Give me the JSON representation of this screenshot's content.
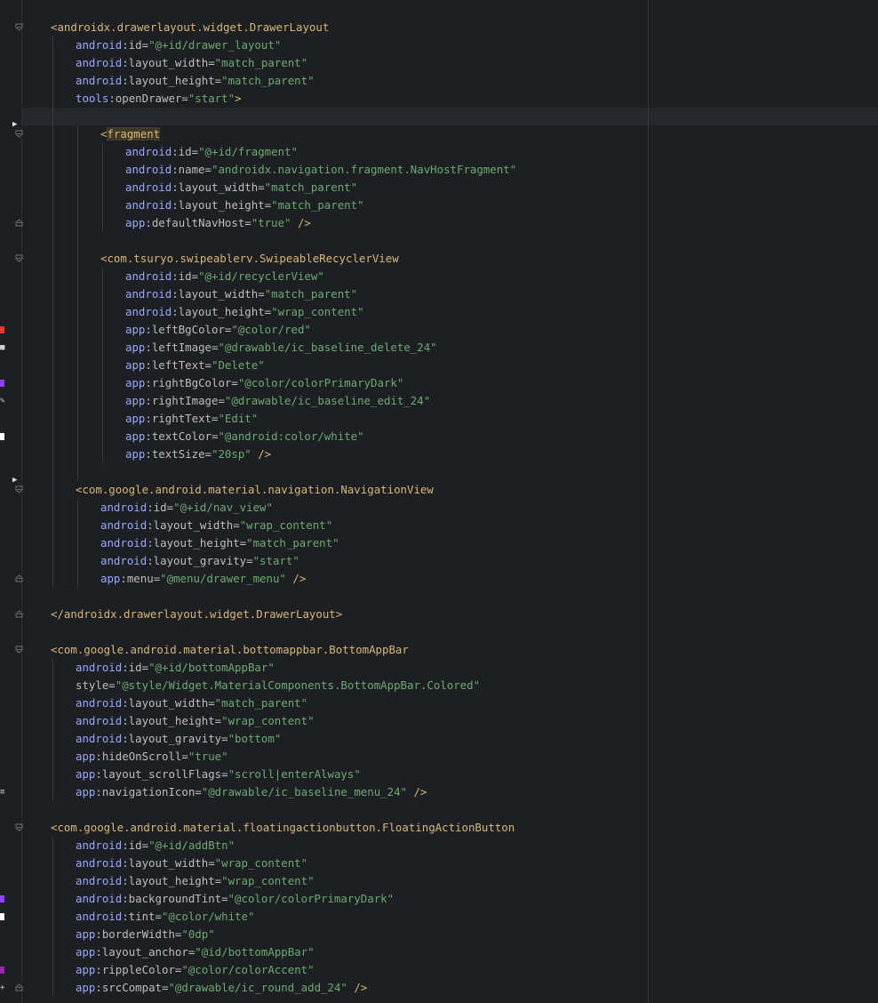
{
  "theme": {
    "background": "#1e1f22",
    "tag_color": "#d5b778",
    "namespace_color": "#9aa7ff",
    "string_color": "#6aab73",
    "text_color": "#bcbec4"
  },
  "gutter": {
    "fold_icon": "fold-marker-icon",
    "run_icon": "run-arrow-icon",
    "color_swatches": [
      {
        "line": 18,
        "color": "#e53935"
      },
      {
        "line": 21,
        "color": "#8e44ff"
      },
      {
        "line": 24,
        "color": "#ffffff"
      },
      {
        "line": 50,
        "color": "#8e44ff"
      },
      {
        "line": 51,
        "color": "#ffffff"
      },
      {
        "line": 54,
        "color": "#9c27b0"
      }
    ]
  },
  "code": {
    "lines": [
      {
        "indent": 0,
        "fold": "open",
        "parts": [
          {
            "t": "<androidx.drawerlayout.widget.DrawerLayout",
            "c": "tag"
          }
        ]
      },
      {
        "indent": 1,
        "parts": [
          {
            "t": "android",
            "c": "ns"
          },
          {
            "t": ":id=",
            "c": "attr"
          },
          {
            "t": "\"@+id/drawer_layout\"",
            "c": "str"
          }
        ]
      },
      {
        "indent": 1,
        "parts": [
          {
            "t": "android",
            "c": "ns"
          },
          {
            "t": ":layout_width=",
            "c": "attr"
          },
          {
            "t": "\"match_parent\"",
            "c": "str"
          }
        ]
      },
      {
        "indent": 1,
        "parts": [
          {
            "t": "android",
            "c": "ns"
          },
          {
            "t": ":layout_height=",
            "c": "attr"
          },
          {
            "t": "\"match_parent\"",
            "c": "str"
          }
        ]
      },
      {
        "indent": 1,
        "parts": [
          {
            "t": "tools",
            "c": "ns"
          },
          {
            "t": ":openDrawer=",
            "c": "attr"
          },
          {
            "t": "\"start\"",
            "c": "str"
          },
          {
            "t": ">",
            "c": "tag"
          }
        ]
      },
      {
        "indent": 0,
        "parts": []
      },
      {
        "indent": 2,
        "fold": "open",
        "run": true,
        "parts": [
          {
            "t": "<",
            "c": "tag"
          },
          {
            "t": "fragment",
            "c": "hl"
          }
        ]
      },
      {
        "indent": 3,
        "parts": [
          {
            "t": "android",
            "c": "ns"
          },
          {
            "t": ":id=",
            "c": "attr"
          },
          {
            "t": "\"@+id/fragment\"",
            "c": "str"
          }
        ]
      },
      {
        "indent": 3,
        "parts": [
          {
            "t": "android",
            "c": "ns"
          },
          {
            "t": ":name=",
            "c": "attr"
          },
          {
            "t": "\"androidx.navigation.fragment.NavHostFragment\"",
            "c": "str"
          }
        ]
      },
      {
        "indent": 3,
        "parts": [
          {
            "t": "android",
            "c": "ns"
          },
          {
            "t": ":layout_width=",
            "c": "attr"
          },
          {
            "t": "\"match_parent\"",
            "c": "str"
          }
        ]
      },
      {
        "indent": 3,
        "parts": [
          {
            "t": "android",
            "c": "ns"
          },
          {
            "t": ":layout_height=",
            "c": "attr"
          },
          {
            "t": "\"match_parent\"",
            "c": "str"
          }
        ]
      },
      {
        "indent": 3,
        "fold": "close",
        "parts": [
          {
            "t": "app",
            "c": "ns"
          },
          {
            "t": ":defaultNavHost=",
            "c": "attr"
          },
          {
            "t": "\"true\"",
            "c": "str"
          },
          {
            "t": " />",
            "c": "tag"
          }
        ]
      },
      {
        "indent": 0,
        "parts": []
      },
      {
        "indent": 2,
        "fold": "open",
        "parts": [
          {
            "t": "<com.tsuryo.swipeablerv.SwipeableRecyclerView",
            "c": "tag"
          }
        ]
      },
      {
        "indent": 3,
        "parts": [
          {
            "t": "android",
            "c": "ns"
          },
          {
            "t": ":id=",
            "c": "attr"
          },
          {
            "t": "\"@+id/recyclerView\"",
            "c": "str"
          }
        ]
      },
      {
        "indent": 3,
        "parts": [
          {
            "t": "android",
            "c": "ns"
          },
          {
            "t": ":layout_width=",
            "c": "attr"
          },
          {
            "t": "\"match_parent\"",
            "c": "str"
          }
        ]
      },
      {
        "indent": 3,
        "parts": [
          {
            "t": "android",
            "c": "ns"
          },
          {
            "t": ":layout_height=",
            "c": "attr"
          },
          {
            "t": "\"wrap_content\"",
            "c": "str"
          }
        ]
      },
      {
        "indent": 3,
        "parts": [
          {
            "t": "app",
            "c": "ns"
          },
          {
            "t": ":leftBgColor=",
            "c": "attr"
          },
          {
            "t": "\"@color/red\"",
            "c": "str"
          }
        ]
      },
      {
        "indent": 3,
        "icon": "delete-icon",
        "parts": [
          {
            "t": "app",
            "c": "ns"
          },
          {
            "t": ":leftImage=",
            "c": "attr"
          },
          {
            "t": "\"@drawable/ic_baseline_delete_24\"",
            "c": "str"
          }
        ]
      },
      {
        "indent": 3,
        "parts": [
          {
            "t": "app",
            "c": "ns"
          },
          {
            "t": ":leftText=",
            "c": "attr"
          },
          {
            "t": "\"Delete\"",
            "c": "str"
          }
        ]
      },
      {
        "indent": 3,
        "parts": [
          {
            "t": "app",
            "c": "ns"
          },
          {
            "t": ":rightBgColor=",
            "c": "attr"
          },
          {
            "t": "\"@color/colorPrimaryDark\"",
            "c": "str"
          }
        ]
      },
      {
        "indent": 3,
        "icon": "edit-icon",
        "parts": [
          {
            "t": "app",
            "c": "ns"
          },
          {
            "t": ":rightImage=",
            "c": "attr"
          },
          {
            "t": "\"@drawable/ic_baseline_edit_24\"",
            "c": "str"
          }
        ]
      },
      {
        "indent": 3,
        "parts": [
          {
            "t": "app",
            "c": "ns"
          },
          {
            "t": ":rightText=",
            "c": "attr"
          },
          {
            "t": "\"Edit\"",
            "c": "str"
          }
        ]
      },
      {
        "indent": 3,
        "parts": [
          {
            "t": "app",
            "c": "ns"
          },
          {
            "t": ":textColor=",
            "c": "attr"
          },
          {
            "t": "\"@android:color/white\"",
            "c": "str"
          }
        ]
      },
      {
        "indent": 3,
        "parts": [
          {
            "t": "app",
            "c": "ns"
          },
          {
            "t": ":textSize=",
            "c": "attr"
          },
          {
            "t": "\"20sp\"",
            "c": "str"
          },
          {
            "t": " />",
            "c": "tag"
          }
        ]
      },
      {
        "indent": 0,
        "parts": []
      },
      {
        "indent": 1,
        "fold": "open",
        "run": true,
        "parts": [
          {
            "t": "<com.google.android.material.navigation.NavigationView",
            "c": "tag"
          }
        ]
      },
      {
        "indent": 2,
        "parts": [
          {
            "t": "android",
            "c": "ns"
          },
          {
            "t": ":id=",
            "c": "attr"
          },
          {
            "t": "\"@+id/nav_view\"",
            "c": "str"
          }
        ]
      },
      {
        "indent": 2,
        "parts": [
          {
            "t": "android",
            "c": "ns"
          },
          {
            "t": ":layout_width=",
            "c": "attr"
          },
          {
            "t": "\"wrap_content\"",
            "c": "str"
          }
        ]
      },
      {
        "indent": 2,
        "parts": [
          {
            "t": "android",
            "c": "ns"
          },
          {
            "t": ":layout_height=",
            "c": "attr"
          },
          {
            "t": "\"match_parent\"",
            "c": "str"
          }
        ]
      },
      {
        "indent": 2,
        "parts": [
          {
            "t": "android",
            "c": "ns"
          },
          {
            "t": ":layout_gravity=",
            "c": "attr"
          },
          {
            "t": "\"start\"",
            "c": "str"
          }
        ]
      },
      {
        "indent": 2,
        "fold": "close",
        "parts": [
          {
            "t": "app",
            "c": "ns"
          },
          {
            "t": ":menu=",
            "c": "attr"
          },
          {
            "t": "\"@menu/drawer_menu\"",
            "c": "str"
          },
          {
            "t": " />",
            "c": "tag"
          }
        ]
      },
      {
        "indent": 0,
        "parts": []
      },
      {
        "indent": 0,
        "fold": "close",
        "parts": [
          {
            "t": "</androidx.drawerlayout.widget.DrawerLayout>",
            "c": "tag"
          }
        ]
      },
      {
        "indent": 0,
        "parts": []
      },
      {
        "indent": 0,
        "fold": "open",
        "parts": [
          {
            "t": "<com.google.android.material.bottomappbar.BottomAppBar",
            "c": "tag"
          }
        ]
      },
      {
        "indent": 1,
        "parts": [
          {
            "t": "android",
            "c": "ns"
          },
          {
            "t": ":id=",
            "c": "attr"
          },
          {
            "t": "\"@+id/bottomAppBar\"",
            "c": "str"
          }
        ]
      },
      {
        "indent": 1,
        "parts": [
          {
            "t": "style=",
            "c": "attr"
          },
          {
            "t": "\"@style/Widget.MaterialComponents.BottomAppBar.Colored\"",
            "c": "str"
          }
        ]
      },
      {
        "indent": 1,
        "parts": [
          {
            "t": "android",
            "c": "ns"
          },
          {
            "t": ":layout_width=",
            "c": "attr"
          },
          {
            "t": "\"match_parent\"",
            "c": "str"
          }
        ]
      },
      {
        "indent": 1,
        "parts": [
          {
            "t": "android",
            "c": "ns"
          },
          {
            "t": ":layout_height=",
            "c": "attr"
          },
          {
            "t": "\"wrap_content\"",
            "c": "str"
          }
        ]
      },
      {
        "indent": 1,
        "parts": [
          {
            "t": "android",
            "c": "ns"
          },
          {
            "t": ":layout_gravity=",
            "c": "attr"
          },
          {
            "t": "\"bottom\"",
            "c": "str"
          }
        ]
      },
      {
        "indent": 1,
        "parts": [
          {
            "t": "app",
            "c": "ns"
          },
          {
            "t": ":hideOnScroll=",
            "c": "attr"
          },
          {
            "t": "\"true\"",
            "c": "str"
          }
        ]
      },
      {
        "indent": 1,
        "parts": [
          {
            "t": "app",
            "c": "ns"
          },
          {
            "t": ":layout_scrollFlags=",
            "c": "attr"
          },
          {
            "t": "\"scroll|enterAlways\"",
            "c": "str"
          }
        ]
      },
      {
        "indent": 1,
        "icon": "menu-icon",
        "parts": [
          {
            "t": "app",
            "c": "ns"
          },
          {
            "t": ":navigationIcon=",
            "c": "attr"
          },
          {
            "t": "\"@drawable/ic_baseline_menu_24\"",
            "c": "str"
          },
          {
            "t": " />",
            "c": "tag"
          }
        ]
      },
      {
        "indent": 0,
        "parts": []
      },
      {
        "indent": 0,
        "fold": "open",
        "parts": [
          {
            "t": "<com.google.android.material.floatingactionbutton.FloatingActionButton",
            "c": "tag"
          }
        ]
      },
      {
        "indent": 1,
        "parts": [
          {
            "t": "android",
            "c": "ns"
          },
          {
            "t": ":id=",
            "c": "attr"
          },
          {
            "t": "\"@+id/addBtn\"",
            "c": "str"
          }
        ]
      },
      {
        "indent": 1,
        "parts": [
          {
            "t": "android",
            "c": "ns"
          },
          {
            "t": ":layout_width=",
            "c": "attr"
          },
          {
            "t": "\"wrap_content\"",
            "c": "str"
          }
        ]
      },
      {
        "indent": 1,
        "parts": [
          {
            "t": "android",
            "c": "ns"
          },
          {
            "t": ":layout_height=",
            "c": "attr"
          },
          {
            "t": "\"wrap_content\"",
            "c": "str"
          }
        ]
      },
      {
        "indent": 1,
        "parts": [
          {
            "t": "android",
            "c": "ns"
          },
          {
            "t": ":backgroundTint=",
            "c": "attr"
          },
          {
            "t": "\"@color/colorPrimaryDark\"",
            "c": "str"
          }
        ]
      },
      {
        "indent": 1,
        "parts": [
          {
            "t": "android",
            "c": "ns"
          },
          {
            "t": ":tint=",
            "c": "attr"
          },
          {
            "t": "\"@color/white\"",
            "c": "str"
          }
        ]
      },
      {
        "indent": 1,
        "parts": [
          {
            "t": "app",
            "c": "ns"
          },
          {
            "t": ":borderWidth=",
            "c": "attr"
          },
          {
            "t": "\"0dp\"",
            "c": "str"
          }
        ]
      },
      {
        "indent": 1,
        "parts": [
          {
            "t": "app",
            "c": "ns"
          },
          {
            "t": ":layout_anchor=",
            "c": "attr"
          },
          {
            "t": "\"@id/bottomAppBar\"",
            "c": "str"
          }
        ]
      },
      {
        "indent": 1,
        "parts": [
          {
            "t": "app",
            "c": "ns"
          },
          {
            "t": ":rippleColor=",
            "c": "attr"
          },
          {
            "t": "\"@color/colorAccent\"",
            "c": "str"
          }
        ]
      },
      {
        "indent": 1,
        "fold": "close",
        "icon": "add-icon",
        "parts": [
          {
            "t": "app",
            "c": "ns"
          },
          {
            "t": ":srcCompat=",
            "c": "attr"
          },
          {
            "t": "\"@drawable/ic_round_add_24\"",
            "c": "str"
          },
          {
            "t": " />",
            "c": "tag"
          }
        ]
      }
    ]
  }
}
